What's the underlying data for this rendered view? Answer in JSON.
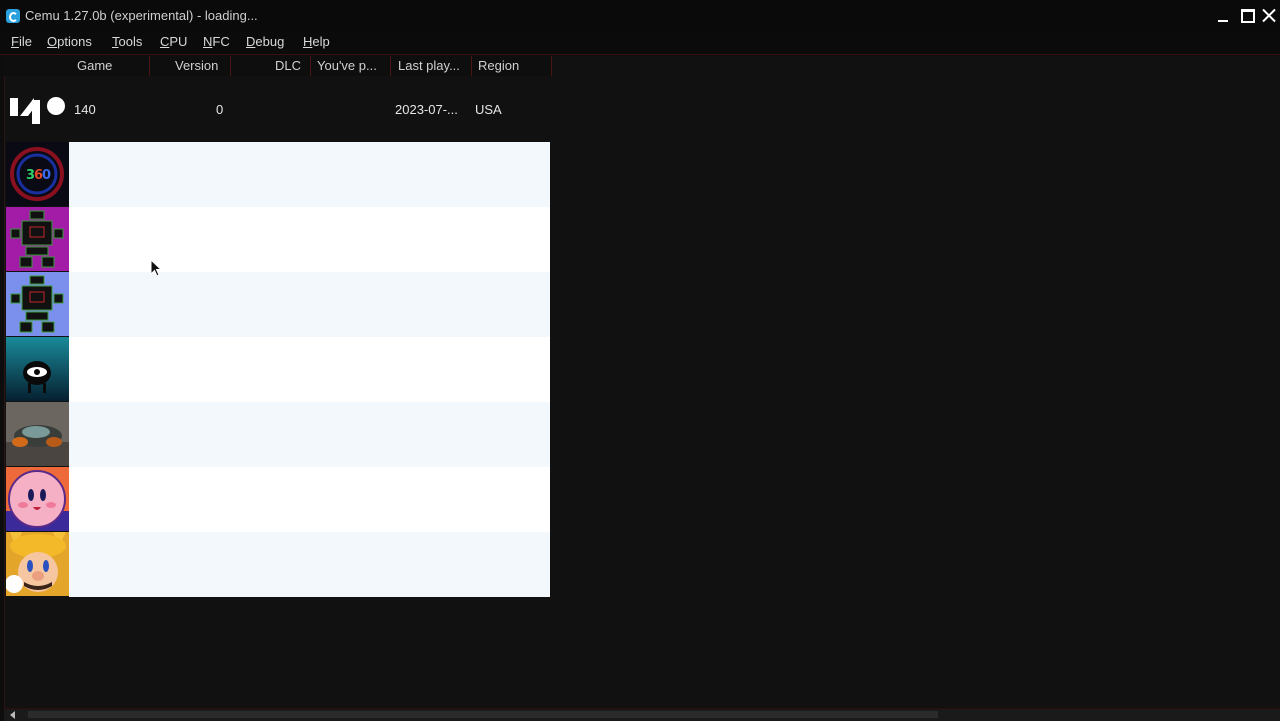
{
  "window": {
    "title": "Cemu 1.27.0b (experimental) - loading...",
    "accent": "#2aa1df"
  },
  "menu": {
    "items": [
      {
        "first": "F",
        "rest": "ile"
      },
      {
        "first": "O",
        "rest": "ptions"
      },
      {
        "first": "T",
        "rest": "ools"
      },
      {
        "first": "C",
        "rest": "PU"
      },
      {
        "first": "N",
        "rest": "FC"
      },
      {
        "first": "D",
        "rest": "ebug"
      },
      {
        "first": "H",
        "rest": "elp"
      }
    ]
  },
  "columns": [
    "Game",
    "Version",
    "DLC",
    "You've p...",
    "Last play...",
    "Region"
  ],
  "rows": [
    {
      "icon": "140-icon",
      "game": "140",
      "version": "0",
      "dlc": "",
      "played": "",
      "last_played": "2023-07-...",
      "region": "USA"
    },
    {
      "icon": "circle-logo-icon"
    },
    {
      "icon": "magenta-robot-icon"
    },
    {
      "icon": "blue-robot-icon"
    },
    {
      "icon": "eye-icon"
    },
    {
      "icon": "spaceship-icon"
    },
    {
      "icon": "kirby-icon"
    },
    {
      "icon": "mario-cat-icon"
    }
  ],
  "colors": {
    "background": "#0d0d0d",
    "border_red": "#4a1515",
    "row_white": "#ffffff",
    "row_tint": "#f3f8fd"
  }
}
